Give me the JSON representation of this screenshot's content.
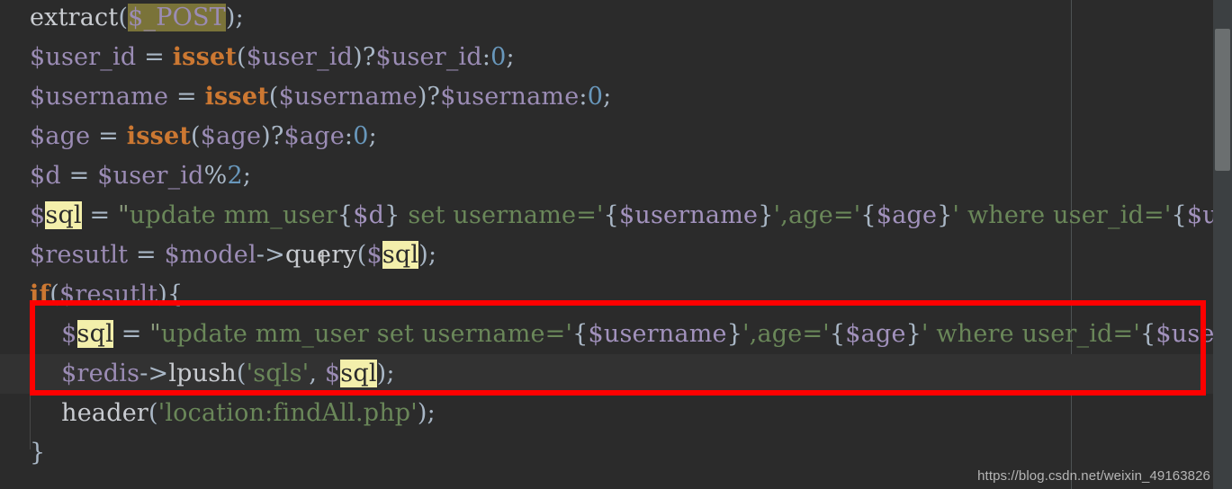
{
  "editor": {
    "language": "php",
    "background_color": "#2b2b2b",
    "current_line_color": "#323232",
    "search_highlight_color": "#f3efab",
    "secondary_highlight_color": "#7a7339",
    "annotation_box_color": "#fe0000",
    "margin_guide_color": "#4e5254",
    "caret_glyph": "I",
    "lines": [
      {
        "index": 0,
        "plain_text": "extract($_POST);",
        "tokens": [
          {
            "t": "extract",
            "cls": "fn"
          },
          {
            "t": "(",
            "cls": "punct"
          },
          {
            "t": "$_POST",
            "cls": "var hl-post"
          },
          {
            "t": ")",
            "cls": "punct"
          },
          {
            "t": ";",
            "cls": "punct"
          }
        ]
      },
      {
        "index": 1,
        "plain_text": "$user_id = isset($user_id)?$user_id:0;",
        "tokens": [
          {
            "t": "$user_id",
            "cls": "var"
          },
          {
            "t": " = ",
            "cls": "op"
          },
          {
            "t": "isset",
            "cls": "kw"
          },
          {
            "t": "(",
            "cls": "punct"
          },
          {
            "t": "$user_id",
            "cls": "var"
          },
          {
            "t": ")?",
            "cls": "punct"
          },
          {
            "t": "$user_id",
            "cls": "var"
          },
          {
            "t": ":",
            "cls": "punct"
          },
          {
            "t": "0",
            "cls": "num"
          },
          {
            "t": ";",
            "cls": "punct"
          }
        ]
      },
      {
        "index": 2,
        "plain_text": "$username = isset($username)?$username:0;",
        "tokens": [
          {
            "t": "$username",
            "cls": "var"
          },
          {
            "t": " = ",
            "cls": "op"
          },
          {
            "t": "isset",
            "cls": "kw"
          },
          {
            "t": "(",
            "cls": "punct"
          },
          {
            "t": "$username",
            "cls": "var"
          },
          {
            "t": ")?",
            "cls": "punct"
          },
          {
            "t": "$username",
            "cls": "var"
          },
          {
            "t": ":",
            "cls": "punct"
          },
          {
            "t": "0",
            "cls": "num"
          },
          {
            "t": ";",
            "cls": "punct"
          }
        ]
      },
      {
        "index": 3,
        "plain_text": "$age = isset($age)?$age:0;",
        "tokens": [
          {
            "t": "$age",
            "cls": "var"
          },
          {
            "t": " = ",
            "cls": "op"
          },
          {
            "t": "isset",
            "cls": "kw"
          },
          {
            "t": "(",
            "cls": "punct"
          },
          {
            "t": "$age",
            "cls": "var"
          },
          {
            "t": ")?",
            "cls": "punct"
          },
          {
            "t": "$age",
            "cls": "var"
          },
          {
            "t": ":",
            "cls": "punct"
          },
          {
            "t": "0",
            "cls": "num"
          },
          {
            "t": ";",
            "cls": "punct"
          }
        ]
      },
      {
        "index": 4,
        "plain_text": "$d = $user_id%2;",
        "tokens": [
          {
            "t": "$d",
            "cls": "var"
          },
          {
            "t": " = ",
            "cls": "op"
          },
          {
            "t": "$user_id",
            "cls": "var"
          },
          {
            "t": "%",
            "cls": "punct"
          },
          {
            "t": "2",
            "cls": "num"
          },
          {
            "t": ";",
            "cls": "punct"
          }
        ]
      },
      {
        "index": 5,
        "plain_text": "$sql = \"update mm_user{$d} set username='{$username}',age='{$age}' where user_id='{$use",
        "tokens": [
          {
            "t": "$",
            "cls": "var"
          },
          {
            "t": "sql",
            "cls": "hl-sql"
          },
          {
            "t": " = ",
            "cls": "op"
          },
          {
            "t": "\"",
            "cls": "strq"
          },
          {
            "t": "update mm_user",
            "cls": "str"
          },
          {
            "t": "{",
            "cls": "punct"
          },
          {
            "t": "$d",
            "cls": "varlt"
          },
          {
            "t": "}",
            "cls": "punct"
          },
          {
            "t": " set username='",
            "cls": "str"
          },
          {
            "t": "{",
            "cls": "punct"
          },
          {
            "t": "$username",
            "cls": "varlt"
          },
          {
            "t": "}",
            "cls": "punct"
          },
          {
            "t": "',age='",
            "cls": "str"
          },
          {
            "t": "{",
            "cls": "punct"
          },
          {
            "t": "$age",
            "cls": "varlt"
          },
          {
            "t": "}",
            "cls": "punct"
          },
          {
            "t": "' where user_id='",
            "cls": "str"
          },
          {
            "t": "{",
            "cls": "punct"
          },
          {
            "t": "$use",
            "cls": "varlt"
          }
        ]
      },
      {
        "index": 6,
        "plain_text": "$resutlt = $model->query($sql);",
        "tokens": [
          {
            "t": "$resutlt",
            "cls": "var"
          },
          {
            "t": " = ",
            "cls": "op"
          },
          {
            "t": "$model",
            "cls": "var"
          },
          {
            "t": "->",
            "cls": "op"
          },
          {
            "t": "query",
            "cls": "fn"
          },
          {
            "t": "(",
            "cls": "punct"
          },
          {
            "t": "$",
            "cls": "var"
          },
          {
            "t": "sql",
            "cls": "hl-sql"
          },
          {
            "t": ")",
            "cls": "punct"
          },
          {
            "t": ";",
            "cls": "punct"
          }
        ]
      },
      {
        "index": 7,
        "plain_text": "if($resutlt){",
        "tokens": [
          {
            "t": "if",
            "cls": "kw"
          },
          {
            "t": "(",
            "cls": "punct"
          },
          {
            "t": "$resutlt",
            "cls": "var"
          },
          {
            "t": ")",
            "cls": "punct"
          },
          {
            "t": "{",
            "cls": "punct"
          }
        ]
      },
      {
        "index": 8,
        "indent": 1,
        "plain_text": "    $sql = \"update mm_user set username='{$username}',age='{$age}' where user_id='{$use",
        "tokens": [
          {
            "t": "    ",
            "cls": "plain"
          },
          {
            "t": "$",
            "cls": "var"
          },
          {
            "t": "sql",
            "cls": "hl-sql"
          },
          {
            "t": " = ",
            "cls": "op"
          },
          {
            "t": "\"",
            "cls": "strq"
          },
          {
            "t": "update mm_user set username='",
            "cls": "str"
          },
          {
            "t": "{",
            "cls": "punct"
          },
          {
            "t": "$username",
            "cls": "varlt"
          },
          {
            "t": "}",
            "cls": "punct"
          },
          {
            "t": "',age='",
            "cls": "str"
          },
          {
            "t": "{",
            "cls": "punct"
          },
          {
            "t": "$age",
            "cls": "varlt"
          },
          {
            "t": "}",
            "cls": "punct"
          },
          {
            "t": "' where user_id='",
            "cls": "str"
          },
          {
            "t": "{",
            "cls": "punct"
          },
          {
            "t": "$use",
            "cls": "varlt"
          }
        ]
      },
      {
        "index": 9,
        "indent": 1,
        "current": true,
        "plain_text": "    $redis->lpush('sqls', $sql);",
        "tokens": [
          {
            "t": "    ",
            "cls": "plain"
          },
          {
            "t": "$redis",
            "cls": "var"
          },
          {
            "t": "->",
            "cls": "op"
          },
          {
            "t": "lpush",
            "cls": "fn"
          },
          {
            "t": "(",
            "cls": "punct"
          },
          {
            "t": "'sqls'",
            "cls": "str"
          },
          {
            "t": ", ",
            "cls": "punct"
          },
          {
            "t": "$",
            "cls": "var"
          },
          {
            "t": "sql",
            "cls": "hl-sql"
          },
          {
            "t": ")",
            "cls": "punct"
          },
          {
            "t": ";",
            "cls": "punct"
          }
        ]
      },
      {
        "index": 10,
        "indent": 1,
        "plain_text": "    header('location:findAll.php');",
        "tokens": [
          {
            "t": "    ",
            "cls": "plain"
          },
          {
            "t": "header",
            "cls": "fn"
          },
          {
            "t": "(",
            "cls": "punct"
          },
          {
            "t": "'location:findAll.php'",
            "cls": "str"
          },
          {
            "t": ")",
            "cls": "punct"
          },
          {
            "t": ";",
            "cls": "punct"
          }
        ]
      },
      {
        "index": 11,
        "plain_text": "}",
        "tokens": [
          {
            "t": "}",
            "cls": "punct"
          }
        ]
      }
    ]
  },
  "annotation": {
    "shape": "rectangle",
    "color": "#fe0000",
    "covers_lines": [
      8,
      9
    ]
  },
  "scrollbar": {
    "orientation": "vertical",
    "thumb_color": "#6b6f70",
    "track_color": "#3c4042"
  },
  "watermark": {
    "text": "https://blog.csdn.net/weixin_49163826"
  }
}
